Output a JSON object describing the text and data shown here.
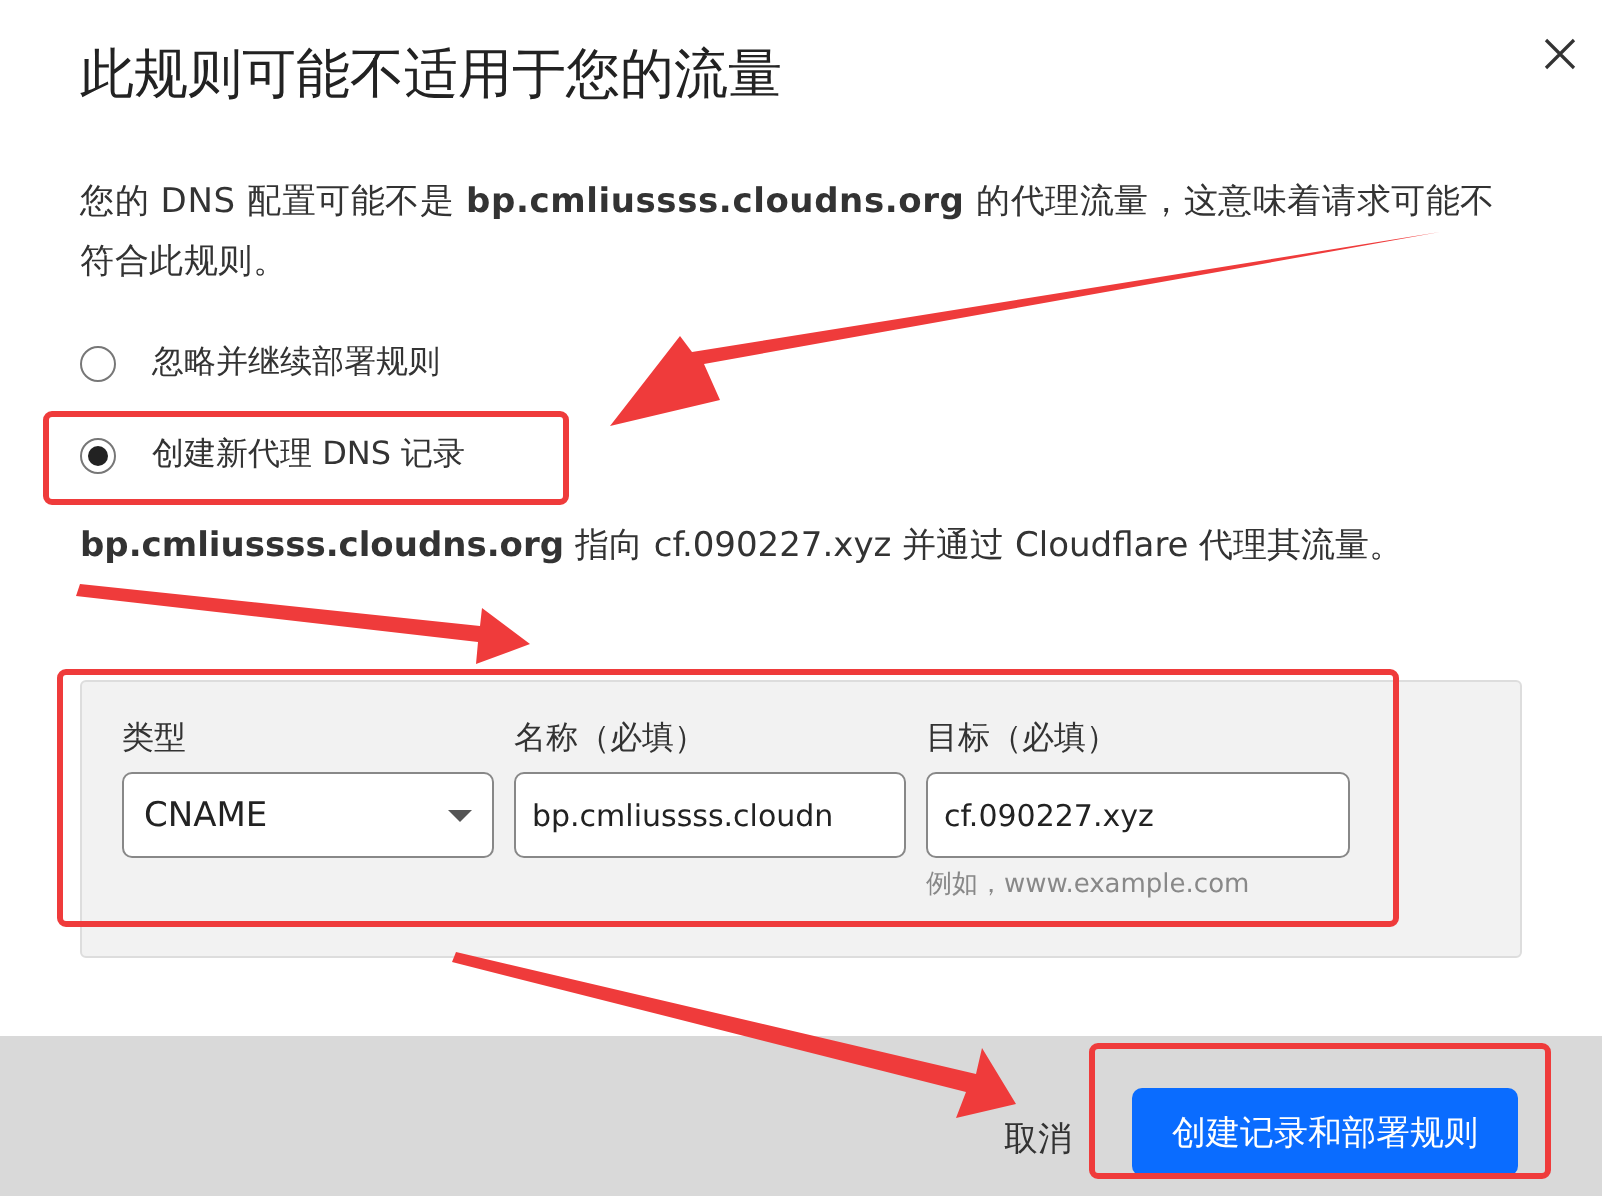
{
  "dialog": {
    "title": "此规则可能不适用于您的流量",
    "description": "您的 DNS 配置可能不是 **bp.cmliussss.cloudns.org** 的代理流量，这意味着请求可能不符合此规则。",
    "options": [
      {
        "label": "忽略并继续部署规则",
        "selected": false
      },
      {
        "label": "创建新代理 DNS 记录",
        "selected": true
      }
    ],
    "summary": "**bp.cmliussss.cloudns.org** 指向 cf.090227.xyz 并通过 Cloudflare 代理其流量。",
    "fields": [
      {
        "kind": "select",
        "label": "类型",
        "value": "CNAME"
      },
      {
        "kind": "input",
        "label": "名称（必填）",
        "value": "bp.cmliussss.cloudn"
      },
      {
        "kind": "input",
        "label": "目标（必填）",
        "value": "cf.090227.xyz",
        "hint": "例如，www.example.com"
      }
    ],
    "cancel": "取消",
    "confirm": "创建记录和部署规则"
  }
}
